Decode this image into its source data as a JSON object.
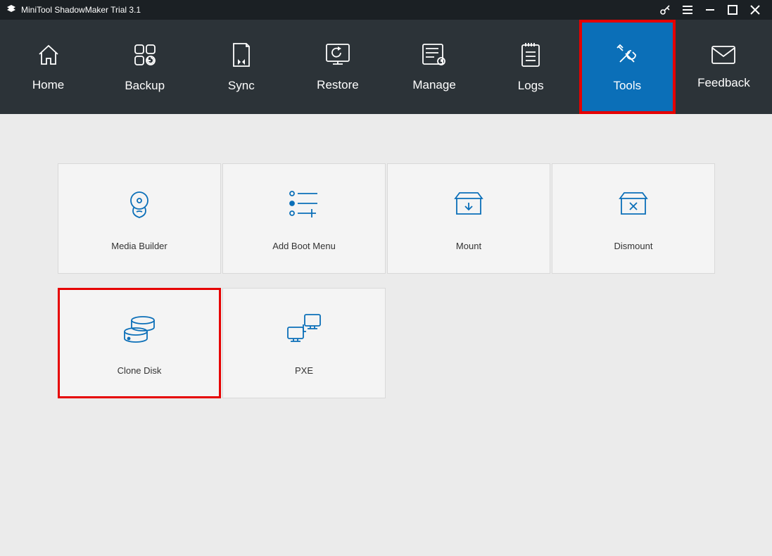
{
  "titlebar": {
    "title": "MiniTool ShadowMaker Trial 3.1"
  },
  "nav": {
    "home": "Home",
    "backup": "Backup",
    "sync": "Sync",
    "restore": "Restore",
    "manage": "Manage",
    "logs": "Logs",
    "tools": "Tools",
    "feedback": "Feedback"
  },
  "tools": {
    "media_builder": "Media Builder",
    "add_boot_menu": "Add Boot Menu",
    "mount": "Mount",
    "dismount": "Dismount",
    "clone_disk": "Clone Disk",
    "pxe": "PXE"
  }
}
